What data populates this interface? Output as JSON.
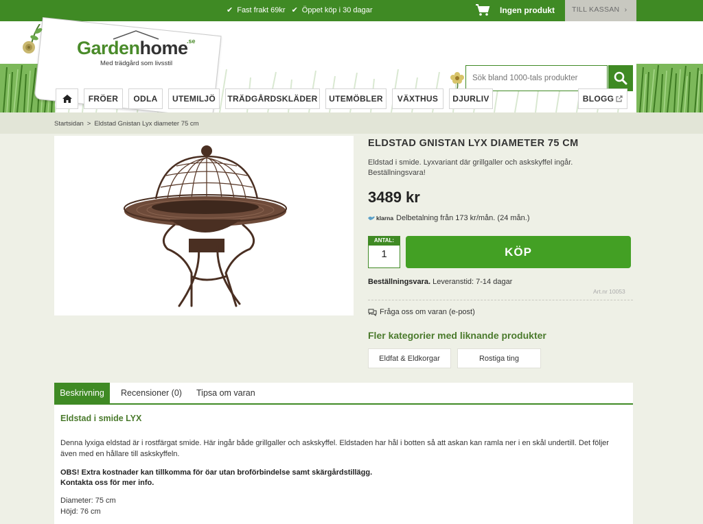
{
  "topbar": {
    "usp1": "Fast frakt 69kr",
    "usp2": "Öppet köp i 30 dagar",
    "cart_label": "Ingen produkt",
    "checkout_label": "TILL KASSAN"
  },
  "brand": {
    "logo_green": "Garden",
    "logo_dark": "home",
    "logo_suffix": ".se",
    "tagline": "Med trädgård som livsstil"
  },
  "search": {
    "placeholder": "Sök bland 1000-tals produkter"
  },
  "nav": {
    "items": [
      "FRÖER",
      "ODLA",
      "UTEMILJÖ",
      "TRÄDGÅRDSKLÄDER",
      "UTEMÖBLER",
      "VÄXTHUS",
      "DJURLIV"
    ],
    "blog": "BLOGG"
  },
  "breadcrumb": {
    "home": "Startsidan",
    "sep": ">",
    "current": "Eldstad Gnistan Lyx diameter 75 cm"
  },
  "product": {
    "title": "ELDSTAD GNISTAN LYX DIAMETER 75 CM",
    "description": "Eldstad i smide. Lyxvariant där grillgaller och askskyffel ingår. Beställningsvara!",
    "price": "3489 kr",
    "klarna_brand": "klarna",
    "klarna_text": "Delbetalning från 173 kr/mån. (24 mån.)",
    "qty_label": "ANTAL:",
    "qty_value": "1",
    "buy_label": "KÖP",
    "stock_bold": "Beställningsvara.",
    "stock_text": "Leveranstid: 7-14 dagar",
    "art_nr": "Art.nr 10053",
    "ask_label": "Fråga oss om varan (e-post)",
    "more_categories_title": "Fler kategorier med liknande produkter",
    "categories": [
      "Eldfat & Eldkorgar",
      "Rostiga ting"
    ]
  },
  "tabs": {
    "items": [
      "Beskrivning",
      "Recensioner (0)",
      "Tipsa om varan"
    ]
  },
  "description": {
    "heading": "Eldstad i smide LYX",
    "paragraph": "Denna lyxiga eldstad är i rostfärgat smide. Här ingår både grillgaller och askskyffel. Eldstaden har hål i botten så att askan kan ramla ner i en skål undertill. Det följer även med en hållare till askskyffeln.",
    "notice_line1": "OBS! Extra kostnader kan tillkomma för öar utan broförbindelse samt skärgårdstillägg.",
    "notice_line2": "Kontakta oss för mer info.",
    "dim1": "Diameter: 75 cm",
    "dim2": "Höjd: 76 cm"
  },
  "colors": {
    "brand_green": "#3f8a24",
    "buy_green": "#43a024",
    "heading_green": "#4a7a2c",
    "background": "#eef0e6"
  }
}
